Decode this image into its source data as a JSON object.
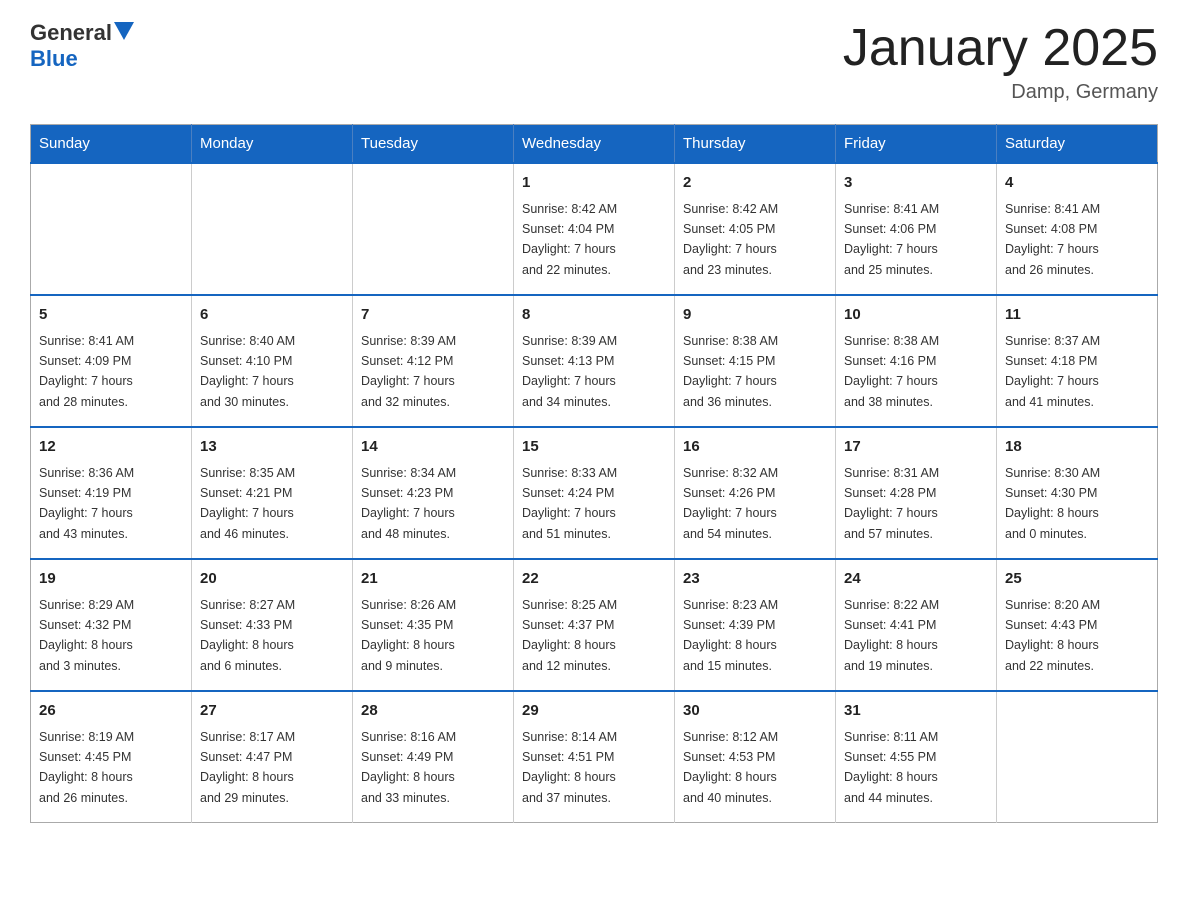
{
  "logo": {
    "text_general": "General",
    "text_blue": "Blue"
  },
  "header": {
    "title": "January 2025",
    "location": "Damp, Germany"
  },
  "weekdays": [
    "Sunday",
    "Monday",
    "Tuesday",
    "Wednesday",
    "Thursday",
    "Friday",
    "Saturday"
  ],
  "weeks": [
    [
      {
        "day": "",
        "info": ""
      },
      {
        "day": "",
        "info": ""
      },
      {
        "day": "",
        "info": ""
      },
      {
        "day": "1",
        "info": "Sunrise: 8:42 AM\nSunset: 4:04 PM\nDaylight: 7 hours\nand 22 minutes."
      },
      {
        "day": "2",
        "info": "Sunrise: 8:42 AM\nSunset: 4:05 PM\nDaylight: 7 hours\nand 23 minutes."
      },
      {
        "day": "3",
        "info": "Sunrise: 8:41 AM\nSunset: 4:06 PM\nDaylight: 7 hours\nand 25 minutes."
      },
      {
        "day": "4",
        "info": "Sunrise: 8:41 AM\nSunset: 4:08 PM\nDaylight: 7 hours\nand 26 minutes."
      }
    ],
    [
      {
        "day": "5",
        "info": "Sunrise: 8:41 AM\nSunset: 4:09 PM\nDaylight: 7 hours\nand 28 minutes."
      },
      {
        "day": "6",
        "info": "Sunrise: 8:40 AM\nSunset: 4:10 PM\nDaylight: 7 hours\nand 30 minutes."
      },
      {
        "day": "7",
        "info": "Sunrise: 8:39 AM\nSunset: 4:12 PM\nDaylight: 7 hours\nand 32 minutes."
      },
      {
        "day": "8",
        "info": "Sunrise: 8:39 AM\nSunset: 4:13 PM\nDaylight: 7 hours\nand 34 minutes."
      },
      {
        "day": "9",
        "info": "Sunrise: 8:38 AM\nSunset: 4:15 PM\nDaylight: 7 hours\nand 36 minutes."
      },
      {
        "day": "10",
        "info": "Sunrise: 8:38 AM\nSunset: 4:16 PM\nDaylight: 7 hours\nand 38 minutes."
      },
      {
        "day": "11",
        "info": "Sunrise: 8:37 AM\nSunset: 4:18 PM\nDaylight: 7 hours\nand 41 minutes."
      }
    ],
    [
      {
        "day": "12",
        "info": "Sunrise: 8:36 AM\nSunset: 4:19 PM\nDaylight: 7 hours\nand 43 minutes."
      },
      {
        "day": "13",
        "info": "Sunrise: 8:35 AM\nSunset: 4:21 PM\nDaylight: 7 hours\nand 46 minutes."
      },
      {
        "day": "14",
        "info": "Sunrise: 8:34 AM\nSunset: 4:23 PM\nDaylight: 7 hours\nand 48 minutes."
      },
      {
        "day": "15",
        "info": "Sunrise: 8:33 AM\nSunset: 4:24 PM\nDaylight: 7 hours\nand 51 minutes."
      },
      {
        "day": "16",
        "info": "Sunrise: 8:32 AM\nSunset: 4:26 PM\nDaylight: 7 hours\nand 54 minutes."
      },
      {
        "day": "17",
        "info": "Sunrise: 8:31 AM\nSunset: 4:28 PM\nDaylight: 7 hours\nand 57 minutes."
      },
      {
        "day": "18",
        "info": "Sunrise: 8:30 AM\nSunset: 4:30 PM\nDaylight: 8 hours\nand 0 minutes."
      }
    ],
    [
      {
        "day": "19",
        "info": "Sunrise: 8:29 AM\nSunset: 4:32 PM\nDaylight: 8 hours\nand 3 minutes."
      },
      {
        "day": "20",
        "info": "Sunrise: 8:27 AM\nSunset: 4:33 PM\nDaylight: 8 hours\nand 6 minutes."
      },
      {
        "day": "21",
        "info": "Sunrise: 8:26 AM\nSunset: 4:35 PM\nDaylight: 8 hours\nand 9 minutes."
      },
      {
        "day": "22",
        "info": "Sunrise: 8:25 AM\nSunset: 4:37 PM\nDaylight: 8 hours\nand 12 minutes."
      },
      {
        "day": "23",
        "info": "Sunrise: 8:23 AM\nSunset: 4:39 PM\nDaylight: 8 hours\nand 15 minutes."
      },
      {
        "day": "24",
        "info": "Sunrise: 8:22 AM\nSunset: 4:41 PM\nDaylight: 8 hours\nand 19 minutes."
      },
      {
        "day": "25",
        "info": "Sunrise: 8:20 AM\nSunset: 4:43 PM\nDaylight: 8 hours\nand 22 minutes."
      }
    ],
    [
      {
        "day": "26",
        "info": "Sunrise: 8:19 AM\nSunset: 4:45 PM\nDaylight: 8 hours\nand 26 minutes."
      },
      {
        "day": "27",
        "info": "Sunrise: 8:17 AM\nSunset: 4:47 PM\nDaylight: 8 hours\nand 29 minutes."
      },
      {
        "day": "28",
        "info": "Sunrise: 8:16 AM\nSunset: 4:49 PM\nDaylight: 8 hours\nand 33 minutes."
      },
      {
        "day": "29",
        "info": "Sunrise: 8:14 AM\nSunset: 4:51 PM\nDaylight: 8 hours\nand 37 minutes."
      },
      {
        "day": "30",
        "info": "Sunrise: 8:12 AM\nSunset: 4:53 PM\nDaylight: 8 hours\nand 40 minutes."
      },
      {
        "day": "31",
        "info": "Sunrise: 8:11 AM\nSunset: 4:55 PM\nDaylight: 8 hours\nand 44 minutes."
      },
      {
        "day": "",
        "info": ""
      }
    ]
  ]
}
